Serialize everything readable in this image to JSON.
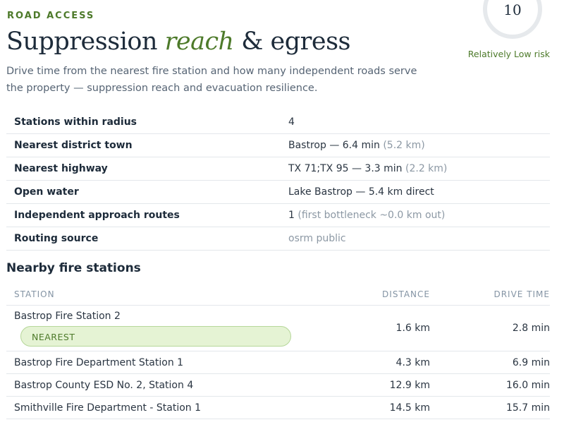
{
  "section": {
    "eyebrow": "ROAD ACCESS",
    "title_a": "Suppression ",
    "title_em": "reach",
    "title_b": " & egress",
    "description": "Drive time from the nearest fire station and how many independent roads serve the property — suppression reach and evacuation resilience."
  },
  "score": {
    "value": "10",
    "fraction": 0.1,
    "label": "Relatively Low risk",
    "color": "#4d7a2a"
  },
  "facts": [
    {
      "label": "Stations within radius",
      "value": "4",
      "note": ""
    },
    {
      "label": "Nearest district town",
      "value": "Bastrop — 6.4 min",
      "note": "(5.2 km)"
    },
    {
      "label": "Nearest highway",
      "value": "TX 71;TX 95 — 3.3 min",
      "note": "(2.2 km)"
    },
    {
      "label": "Open water",
      "value": "Lake Bastrop — 5.4 km direct",
      "note": ""
    },
    {
      "label": "Independent approach routes",
      "value": "1",
      "note": "(first bottleneck ~0.0 km out)"
    },
    {
      "label": "Routing source",
      "value": "",
      "note": "osrm public"
    }
  ],
  "stations": {
    "title": "Nearby fire stations",
    "columns": {
      "name": "STATION",
      "distance": "DISTANCE",
      "drive_time": "DRIVE TIME"
    },
    "nearest_label": "NEAREST",
    "rows": [
      {
        "name": "Bastrop Fire Station 2",
        "distance": "1.6 km",
        "drive_time": "2.8 min"
      },
      {
        "name": "Bastrop Fire Department Station 1",
        "distance": "4.3 km",
        "drive_time": "6.9 min"
      },
      {
        "name": "Bastrop County ESD No. 2, Station 4",
        "distance": "12.9 km",
        "drive_time": "16.0 min"
      },
      {
        "name": "Smithville Fire Department - Station 1",
        "distance": "14.5 km",
        "drive_time": "15.7 min"
      }
    ]
  },
  "colors": {
    "accent": "#4d7a2a",
    "badge_bg": "#e5f3d4",
    "muted": "#8c98a4"
  }
}
